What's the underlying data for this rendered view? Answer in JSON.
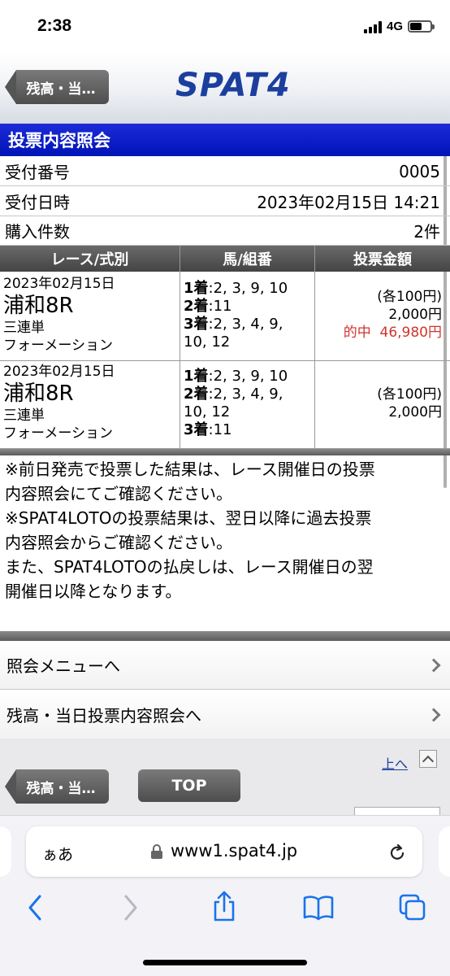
{
  "status_bar": {
    "time": "2:38",
    "network": "4G"
  },
  "header": {
    "back_label": "残高・当…",
    "logo": "SPAT4"
  },
  "page_title": "投票内容照会",
  "info": {
    "receipt_number_label": "受付番号",
    "receipt_number": "0005",
    "receipt_datetime_label": "受付日時",
    "receipt_datetime": "2023年02月15日 14:21",
    "purchase_count_label": "購入件数",
    "purchase_count": "2件"
  },
  "table": {
    "headers": [
      "レース/式別",
      "馬/組番",
      "投票金額"
    ],
    "rows": [
      {
        "date": "2023年02月15日",
        "race": "浦和8R",
        "bet_type": "三連単",
        "method": "フォーメーション",
        "first_label": "1着",
        "first": ":2, 3, 9, 10",
        "second_label": "2着",
        "second": ":11",
        "third_label": "3着",
        "third_line1": ":2, 3, 4, 9,",
        "third_line2": "10, 12",
        "unit_amount": "(各100円)",
        "total_amount": "2,000円",
        "hit_label": "的中",
        "hit_amount": "46,980円"
      },
      {
        "date": "2023年02月15日",
        "race": "浦和8R",
        "bet_type": "三連単",
        "method": "フォーメーション",
        "first_label": "1着",
        "first": ":2, 3, 9, 10",
        "second_label": "2着",
        "second_line1": ":2, 3, 4, 9,",
        "second_line2": "10, 12",
        "third_label": "3着",
        "third": ":11",
        "unit_amount": "(各100円)",
        "total_amount": "2,000円"
      }
    ]
  },
  "notes": [
    "※前日発売で投票した結果は、レース開催日の投票",
    "内容照会にてご確認ください。",
    "※SPAT4LOTOの投票結果は、翌日以降に過去投票",
    "内容照会からご確認ください。",
    "また、SPAT4LOTOの払戻しは、レース開催日の翌",
    "開催日以降となります。"
  ],
  "menu": {
    "inquiry_menu": "照会メニューへ",
    "balance_inquiry": "残高・当日投票内容照会へ"
  },
  "footer": {
    "back_label": "残高・当…",
    "top_label": "TOP",
    "up_label": "上へ"
  },
  "browser": {
    "aa_label": "ぁあ",
    "url": "www1.spat4.jp"
  }
}
